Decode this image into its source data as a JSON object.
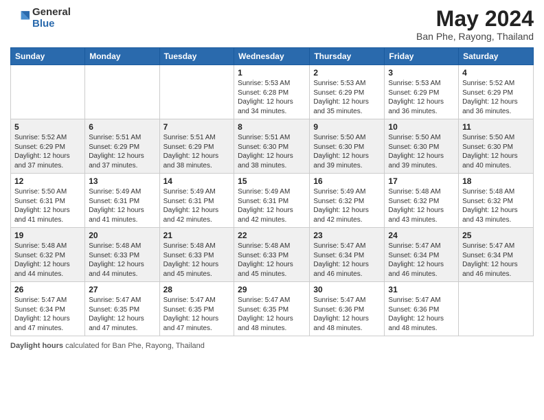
{
  "header": {
    "logo_general": "General",
    "logo_blue": "Blue",
    "title": "May 2024",
    "location": "Ban Phe, Rayong, Thailand"
  },
  "days_of_week": [
    "Sunday",
    "Monday",
    "Tuesday",
    "Wednesday",
    "Thursday",
    "Friday",
    "Saturday"
  ],
  "weeks": [
    [
      {
        "day": "",
        "info": ""
      },
      {
        "day": "",
        "info": ""
      },
      {
        "day": "",
        "info": ""
      },
      {
        "day": "1",
        "info": "Sunrise: 5:53 AM\nSunset: 6:28 PM\nDaylight: 12 hours\nand 34 minutes."
      },
      {
        "day": "2",
        "info": "Sunrise: 5:53 AM\nSunset: 6:29 PM\nDaylight: 12 hours\nand 35 minutes."
      },
      {
        "day": "3",
        "info": "Sunrise: 5:53 AM\nSunset: 6:29 PM\nDaylight: 12 hours\nand 36 minutes."
      },
      {
        "day": "4",
        "info": "Sunrise: 5:52 AM\nSunset: 6:29 PM\nDaylight: 12 hours\nand 36 minutes."
      }
    ],
    [
      {
        "day": "5",
        "info": "Sunrise: 5:52 AM\nSunset: 6:29 PM\nDaylight: 12 hours\nand 37 minutes."
      },
      {
        "day": "6",
        "info": "Sunrise: 5:51 AM\nSunset: 6:29 PM\nDaylight: 12 hours\nand 37 minutes."
      },
      {
        "day": "7",
        "info": "Sunrise: 5:51 AM\nSunset: 6:29 PM\nDaylight: 12 hours\nand 38 minutes."
      },
      {
        "day": "8",
        "info": "Sunrise: 5:51 AM\nSunset: 6:30 PM\nDaylight: 12 hours\nand 38 minutes."
      },
      {
        "day": "9",
        "info": "Sunrise: 5:50 AM\nSunset: 6:30 PM\nDaylight: 12 hours\nand 39 minutes."
      },
      {
        "day": "10",
        "info": "Sunrise: 5:50 AM\nSunset: 6:30 PM\nDaylight: 12 hours\nand 39 minutes."
      },
      {
        "day": "11",
        "info": "Sunrise: 5:50 AM\nSunset: 6:30 PM\nDaylight: 12 hours\nand 40 minutes."
      }
    ],
    [
      {
        "day": "12",
        "info": "Sunrise: 5:50 AM\nSunset: 6:31 PM\nDaylight: 12 hours\nand 41 minutes."
      },
      {
        "day": "13",
        "info": "Sunrise: 5:49 AM\nSunset: 6:31 PM\nDaylight: 12 hours\nand 41 minutes."
      },
      {
        "day": "14",
        "info": "Sunrise: 5:49 AM\nSunset: 6:31 PM\nDaylight: 12 hours\nand 42 minutes."
      },
      {
        "day": "15",
        "info": "Sunrise: 5:49 AM\nSunset: 6:31 PM\nDaylight: 12 hours\nand 42 minutes."
      },
      {
        "day": "16",
        "info": "Sunrise: 5:49 AM\nSunset: 6:32 PM\nDaylight: 12 hours\nand 42 minutes."
      },
      {
        "day": "17",
        "info": "Sunrise: 5:48 AM\nSunset: 6:32 PM\nDaylight: 12 hours\nand 43 minutes."
      },
      {
        "day": "18",
        "info": "Sunrise: 5:48 AM\nSunset: 6:32 PM\nDaylight: 12 hours\nand 43 minutes."
      }
    ],
    [
      {
        "day": "19",
        "info": "Sunrise: 5:48 AM\nSunset: 6:32 PM\nDaylight: 12 hours\nand 44 minutes."
      },
      {
        "day": "20",
        "info": "Sunrise: 5:48 AM\nSunset: 6:33 PM\nDaylight: 12 hours\nand 44 minutes."
      },
      {
        "day": "21",
        "info": "Sunrise: 5:48 AM\nSunset: 6:33 PM\nDaylight: 12 hours\nand 45 minutes."
      },
      {
        "day": "22",
        "info": "Sunrise: 5:48 AM\nSunset: 6:33 PM\nDaylight: 12 hours\nand 45 minutes."
      },
      {
        "day": "23",
        "info": "Sunrise: 5:47 AM\nSunset: 6:34 PM\nDaylight: 12 hours\nand 46 minutes."
      },
      {
        "day": "24",
        "info": "Sunrise: 5:47 AM\nSunset: 6:34 PM\nDaylight: 12 hours\nand 46 minutes."
      },
      {
        "day": "25",
        "info": "Sunrise: 5:47 AM\nSunset: 6:34 PM\nDaylight: 12 hours\nand 46 minutes."
      }
    ],
    [
      {
        "day": "26",
        "info": "Sunrise: 5:47 AM\nSunset: 6:34 PM\nDaylight: 12 hours\nand 47 minutes."
      },
      {
        "day": "27",
        "info": "Sunrise: 5:47 AM\nSunset: 6:35 PM\nDaylight: 12 hours\nand 47 minutes."
      },
      {
        "day": "28",
        "info": "Sunrise: 5:47 AM\nSunset: 6:35 PM\nDaylight: 12 hours\nand 47 minutes."
      },
      {
        "day": "29",
        "info": "Sunrise: 5:47 AM\nSunset: 6:35 PM\nDaylight: 12 hours\nand 48 minutes."
      },
      {
        "day": "30",
        "info": "Sunrise: 5:47 AM\nSunset: 6:36 PM\nDaylight: 12 hours\nand 48 minutes."
      },
      {
        "day": "31",
        "info": "Sunrise: 5:47 AM\nSunset: 6:36 PM\nDaylight: 12 hours\nand 48 minutes."
      },
      {
        "day": "",
        "info": ""
      }
    ]
  ],
  "footer": {
    "label": "Daylight hours",
    "description": "calculated for Ban Phe, Rayong, Thailand"
  }
}
